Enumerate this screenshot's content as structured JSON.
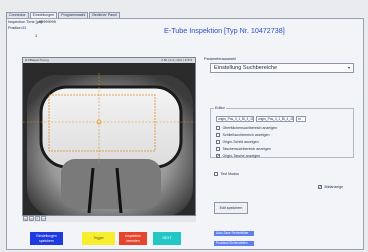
{
  "tabs": [
    "Connector",
    "Einstellungen",
    "Programmwahl",
    "Bediener Panel"
  ],
  "inspection_time_label": "Inspection Time [µs]:",
  "inspection_time_value": "99999999",
  "position_label": "Position:",
  "position_value": "33",
  "counter_value": "1",
  "title": "E-Tube Inspektion [Typ Nr. 10472738]",
  "image_panel": {
    "filename": "i0.f/BtappnT3.png",
    "info_right": "2.50 | 0.4 | 10.0 | 176   5"
  },
  "zoom_buttons": [
    "Q",
    "Q",
    "⇱",
    "▭"
  ],
  "parameter_label": "Parameterauswahl",
  "parameter_select": "Einstellung Suchbereiche",
  "editor": {
    "label": "Editor",
    "combo1": "origin_Pos_3_1_Bl_3_15]",
    "combo2": "origin_Pos_4_1_Bl_4_15]",
    "combo3": "nt"
  },
  "checkboxes": [
    {
      "label": "Oberflächensuchbereich anzeigen",
      "checked": false
    },
    {
      "label": "Schließsuchbereich anzeigen",
      "checked": false
    },
    {
      "label": "Origin-Schild anzeigen",
      "checked": false
    },
    {
      "label": "Taschensuchbereich anzeigen",
      "checked": false
    },
    {
      "label": "Origin-Tasche anzeigen",
      "checked": true
    }
  ],
  "test_modus": "Test Modus",
  "bildanzeige": "Bildanzeige",
  "save_button": "Edit speichern",
  "bottom_buttons": [
    {
      "label": "Einstellungen speichern",
      "color": "#1f3be0",
      "text_color": "#ffffff"
    },
    {
      "label": "Trigger",
      "color": "#f6ee2e",
      "text_color": "#5b5b1a"
    },
    {
      "label": "Inspektion beenden",
      "color": "#e3452d",
      "text_color": "#ffffff"
    },
    {
      "label": "NEXT",
      "color": "#22c7c6",
      "text_color": "#ffffff"
    }
  ],
  "small_buttons": [
    "Auto Save Fehlerbilder",
    "Protokoll Sicherstellen"
  ]
}
